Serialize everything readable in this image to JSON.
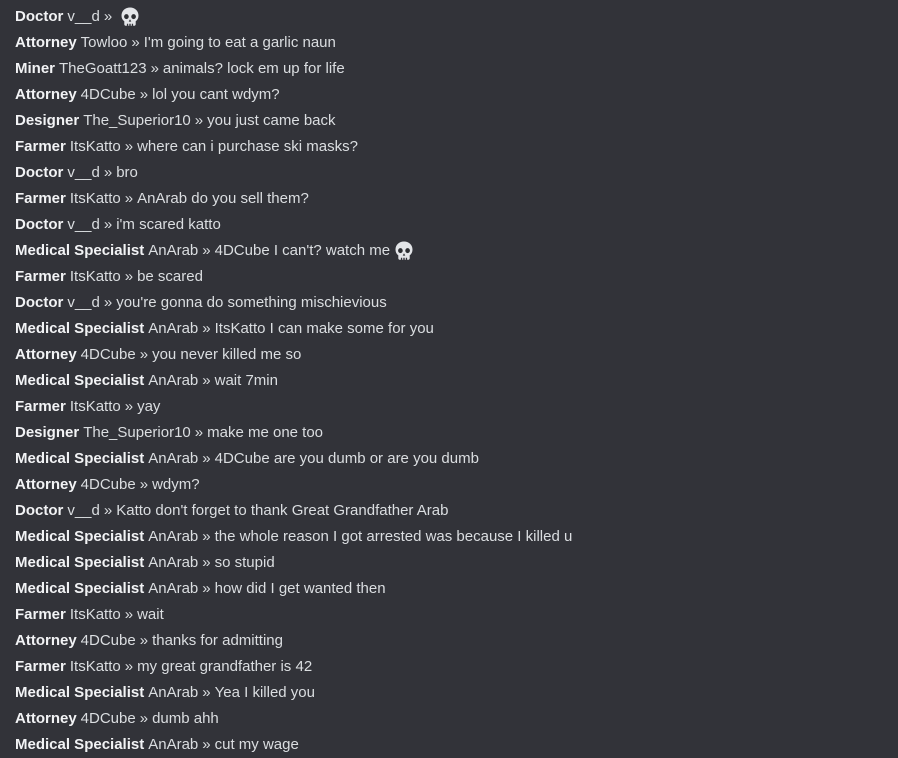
{
  "emoji": {
    "skull": "skull-icon"
  },
  "colors": {
    "background": "#323339",
    "text": "#dbdee1",
    "role": "#f2f3f5"
  },
  "messages": [
    {
      "role": "Doctor",
      "user": "v__d",
      "sep": "»",
      "text": "",
      "emoji": "skull"
    },
    {
      "role": "Attorney",
      "user": "Towloo",
      "sep": "»",
      "text": "I'm going to eat a garlic naun"
    },
    {
      "role": "Miner",
      "user": "TheGoatt123",
      "sep": "»",
      "text": "animals? lock em up for life"
    },
    {
      "role": "Attorney",
      "user": "4DCube",
      "sep": "»",
      "text": "lol you cant wdym?"
    },
    {
      "role": "Designer",
      "user": "The_Superior10",
      "sep": "»",
      "text": "you just came back"
    },
    {
      "role": "Farmer",
      "user": "ItsKatto",
      "sep": "»",
      "text": "where can i purchase ski masks?"
    },
    {
      "role": "Doctor",
      "user": "v__d",
      "sep": "»",
      "text": "bro"
    },
    {
      "role": "Farmer",
      "user": "ItsKatto",
      "sep": "»",
      "text": "AnArab do you sell them?"
    },
    {
      "role": "Doctor",
      "user": "v__d",
      "sep": "»",
      "text": "i'm scared katto"
    },
    {
      "role": "Medical Specialist",
      "user": "AnArab",
      "sep": "»",
      "text": "4DCube I can't? watch me",
      "emoji": "skull"
    },
    {
      "role": "Farmer",
      "user": "ItsKatto",
      "sep": "»",
      "text": "be scared"
    },
    {
      "role": "Doctor",
      "user": "v__d",
      "sep": "»",
      "text": "you're gonna do something mischievious"
    },
    {
      "role": "Medical Specialist",
      "user": "AnArab",
      "sep": "»",
      "text": "ItsKatto I can make some for you"
    },
    {
      "role": "Attorney",
      "user": "4DCube",
      "sep": "»",
      "text": "you never killed me so"
    },
    {
      "role": "Medical Specialist",
      "user": "AnArab",
      "sep": "»",
      "text": "wait 7min"
    },
    {
      "role": "Farmer",
      "user": "ItsKatto",
      "sep": "»",
      "text": "yay"
    },
    {
      "role": "Designer",
      "user": "The_Superior10",
      "sep": "»",
      "text": "make me one too"
    },
    {
      "role": "Medical Specialist",
      "user": "AnArab",
      "sep": "»",
      "text": "4DCube are you dumb or are you dumb"
    },
    {
      "role": "Attorney",
      "user": "4DCube",
      "sep": "»",
      "text": "wdym?"
    },
    {
      "role": "Doctor",
      "user": "v__d",
      "sep": "»",
      "text": "Katto don't forget to thank Great Grandfather Arab"
    },
    {
      "role": "Medical Specialist",
      "user": "AnArab",
      "sep": "»",
      "text": "the whole reason I got arrested was because I killed u"
    },
    {
      "role": "Medical Specialist",
      "user": "AnArab",
      "sep": "»",
      "text": "so stupid"
    },
    {
      "role": "Medical Specialist",
      "user": "AnArab",
      "sep": "»",
      "text": "how did I get wanted then"
    },
    {
      "role": "Farmer",
      "user": "ItsKatto",
      "sep": "»",
      "text": "wait"
    },
    {
      "role": "Attorney",
      "user": "4DCube",
      "sep": "»",
      "text": "thanks for admitting"
    },
    {
      "role": "Farmer",
      "user": "ItsKatto",
      "sep": "»",
      "text": "my great grandfather is 42"
    },
    {
      "role": "Medical Specialist",
      "user": "AnArab",
      "sep": "»",
      "text": "Yea I killed you"
    },
    {
      "role": "Attorney",
      "user": "4DCube",
      "sep": "»",
      "text": "dumb ahh"
    },
    {
      "role": "Medical Specialist",
      "user": "AnArab",
      "sep": "»",
      "text": "cut my wage"
    }
  ]
}
